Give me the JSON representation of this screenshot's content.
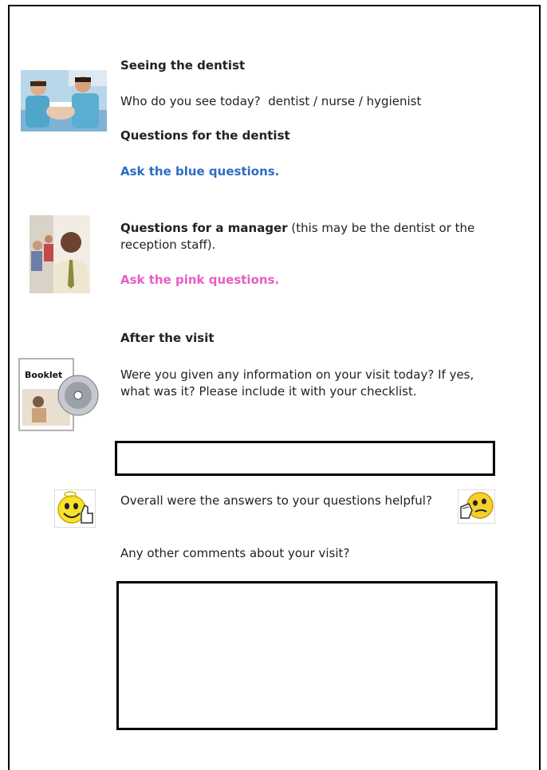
{
  "sections": {
    "seeing_dentist": {
      "title": "Seeing the dentist",
      "who_question": "Who do you see today?  dentist / nurse / hygienist",
      "questions_heading": "Questions for the dentist",
      "instruction": "Ask the blue questions.",
      "image_icon": "dentist-photo-icon"
    },
    "manager": {
      "heading": "Questions for a manager",
      "heading_note": " (this may be the dentist or the reception staff).",
      "instruction": "Ask the pink questions.",
      "image_icon": "manager-photo-icon"
    },
    "after_visit": {
      "title": "After the visit",
      "info_question": "Were you given any information on your visit today? If yes, what was it? Please include it with your checklist.",
      "booklet_label": "Booklet",
      "image_icon": "booklet-cd-icon",
      "info_answer": ""
    },
    "rating": {
      "question": "Overall were the answers to your questions helpful?",
      "positive_icon": "smiley-thumbs-up-icon",
      "negative_icon": "smiley-thinking-icon"
    },
    "comments": {
      "question": "Any other comments about your visit?",
      "answer": ""
    }
  },
  "colors": {
    "blue_text": "#2e6cc4",
    "pink_text": "#e85cc6",
    "border": "#000000"
  }
}
